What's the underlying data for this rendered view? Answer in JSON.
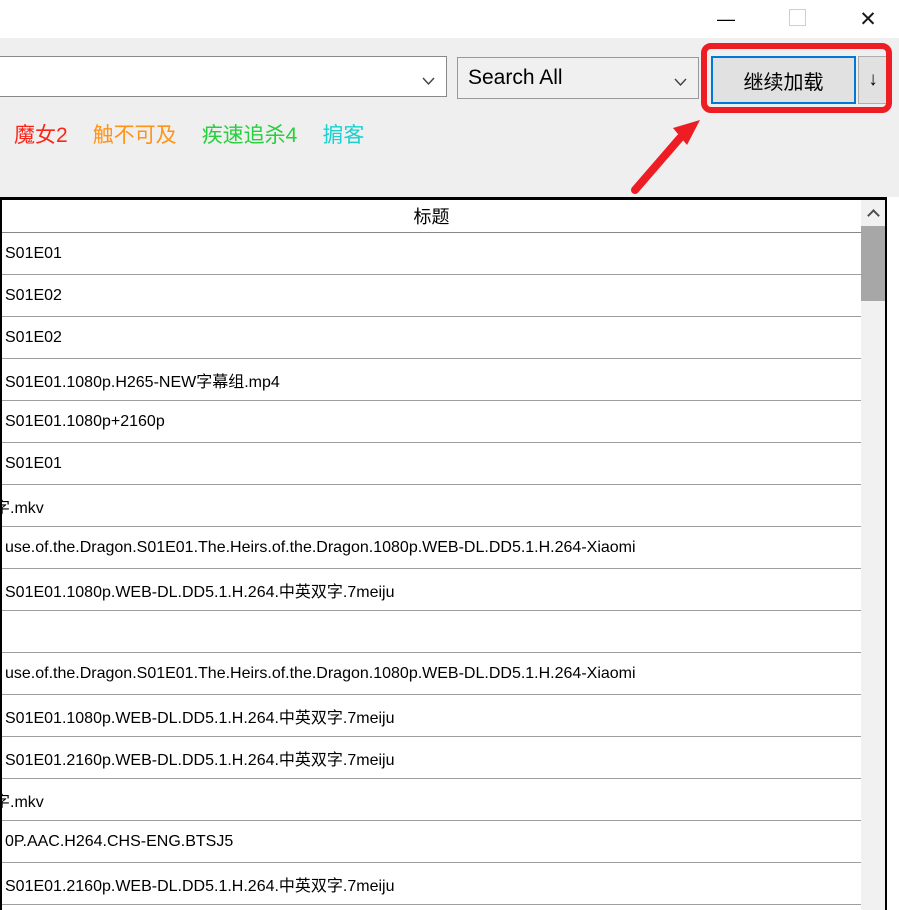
{
  "window": {
    "controls": {
      "minimize": "—",
      "close": "✕"
    }
  },
  "toolbar": {
    "search_combo": {
      "value": ""
    },
    "scope_combo": {
      "value": "Search All"
    },
    "load_more_button": {
      "label": "继续加载"
    },
    "download_button": {
      "label": "↓"
    }
  },
  "quick_links": [
    {
      "label": "魔女2",
      "color": "#fb2619"
    },
    {
      "label": "触不可及",
      "color": "#ff9318"
    },
    {
      "label": "疾速追杀4",
      "color": "#25d03c"
    },
    {
      "label": "掮客",
      "color": "#1ad1d1"
    }
  ],
  "annotation": {
    "color": "#ee1c23"
  },
  "table": {
    "header": "标题",
    "rows": [
      {
        "text": "S01E01",
        "clipped": false
      },
      {
        "text": "S01E02",
        "clipped": false
      },
      {
        "text": "S01E02",
        "clipped": false
      },
      {
        "text": "S01E01.1080p.H265-NEW字幕组.mp4",
        "clipped": false
      },
      {
        "text": "S01E01.1080p+2160p",
        "clipped": false
      },
      {
        "text": "S01E01",
        "clipped": false
      },
      {
        "text": "字.mkv",
        "clipped": true
      },
      {
        "text": "use.of.the.Dragon.S01E01.The.Heirs.of.the.Dragon.1080p.WEB-DL.DD5.1.H.264-Xiaomi",
        "clipped": false
      },
      {
        "text": "S01E01.1080p.WEB-DL.DD5.1.H.264.中英双字.7meiju",
        "clipped": false
      },
      {
        "text": "",
        "clipped": false
      },
      {
        "text": "use.of.the.Dragon.S01E01.The.Heirs.of.the.Dragon.1080p.WEB-DL.DD5.1.H.264-Xiaomi",
        "clipped": false
      },
      {
        "text": "S01E01.1080p.WEB-DL.DD5.1.H.264.中英双字.7meiju",
        "clipped": false
      },
      {
        "text": "S01E01.2160p.WEB-DL.DD5.1.H.264.中英双字.7meiju",
        "clipped": false
      },
      {
        "text": "字.mkv",
        "clipped": true
      },
      {
        "text": "0P.AAC.H264.CHS-ENG.BTSJ5",
        "clipped": false
      },
      {
        "text": "S01E01.2160p.WEB-DL.DD5.1.H.264.中英双字.7meiju",
        "clipped": false
      }
    ]
  }
}
